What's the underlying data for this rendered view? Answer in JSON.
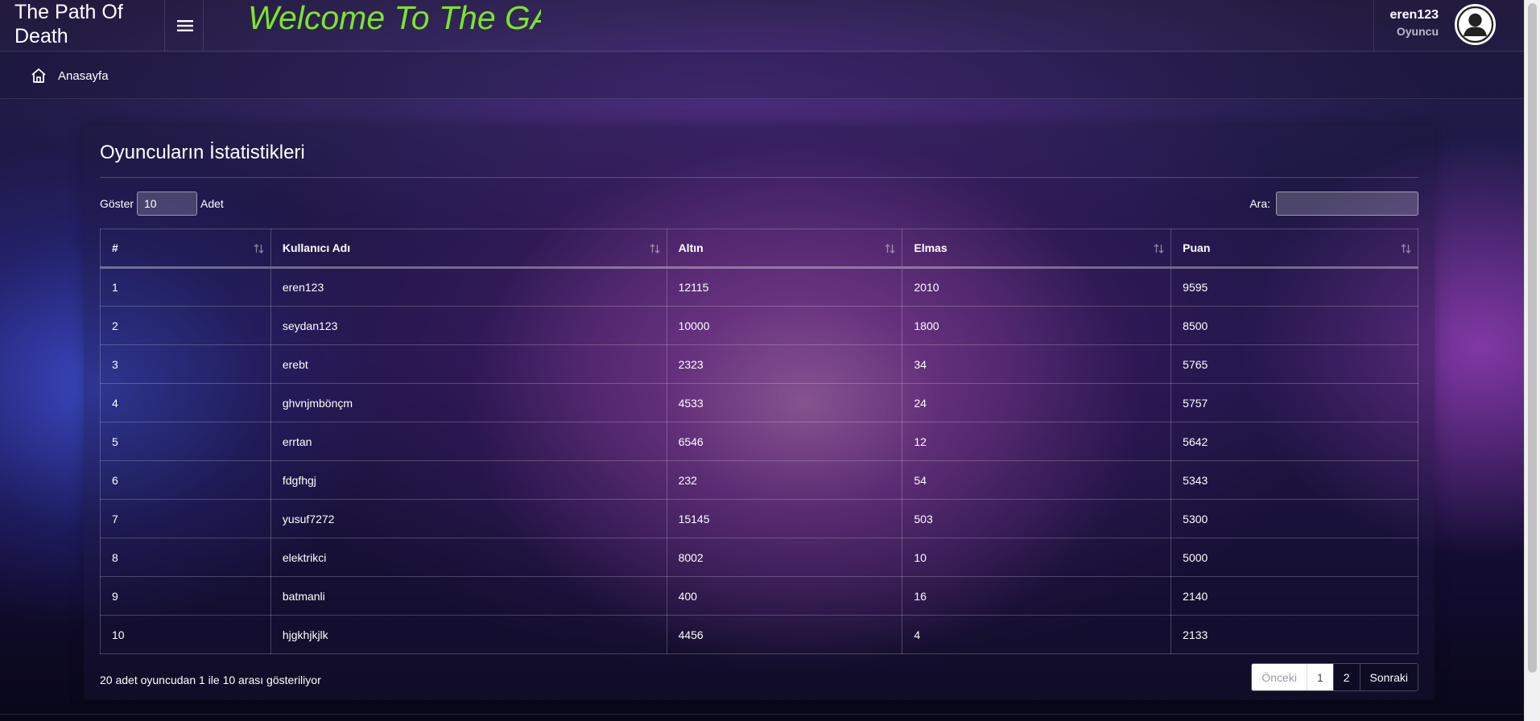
{
  "header": {
    "brand_title": "The Path Of Death",
    "welcome_text": "Welcome To The GAME",
    "user_name": "eren123",
    "user_role": "Oyuncu",
    "menu_icon": "hamburger-menu-icon",
    "avatar_icon": "user-avatar-icon"
  },
  "breadcrumb": {
    "icon": "home-icon",
    "label": "Anasayfa"
  },
  "panel": {
    "title": "Oyuncuların İstatistikleri",
    "length_label_before": "Göster",
    "length_value": "10",
    "length_label_after": "Adet",
    "search_label": "Ara:",
    "search_value": ""
  },
  "table": {
    "columns": [
      "#",
      "Kullanıcı Adı",
      "Altın",
      "Elmas",
      "Puan"
    ],
    "rows": [
      [
        "1",
        "eren123",
        "12115",
        "2010",
        "9595"
      ],
      [
        "2",
        "seydan123",
        "10000",
        "1800",
        "8500"
      ],
      [
        "3",
        "erebt",
        "2323",
        "34",
        "5765"
      ],
      [
        "4",
        "ghvnjmbönçm",
        "4533",
        "24",
        "5757"
      ],
      [
        "5",
        "errtan",
        "6546",
        "12",
        "5642"
      ],
      [
        "6",
        "fdgfhgj",
        "232",
        "54",
        "5343"
      ],
      [
        "7",
        "yusuf7272",
        "15145",
        "503",
        "5300"
      ],
      [
        "8",
        "elektrikci",
        "8002",
        "10",
        "5000"
      ],
      [
        "9",
        "batmanli",
        "400",
        "16",
        "2140"
      ],
      [
        "10",
        "hjgkhjkjlk",
        "4456",
        "4",
        "2133"
      ]
    ],
    "sort_icon": "sort-arrows-icon"
  },
  "footer": {
    "info": "20 adet oyuncudan 1 ile 10 arası gösteriliyor",
    "prev_label": "Önceki",
    "page_1": "1",
    "page_2": "2",
    "next_label": "Sonraki",
    "current_page": 1
  },
  "colors": {
    "welcome_text": "#7de32b",
    "text": "#ffffff"
  }
}
